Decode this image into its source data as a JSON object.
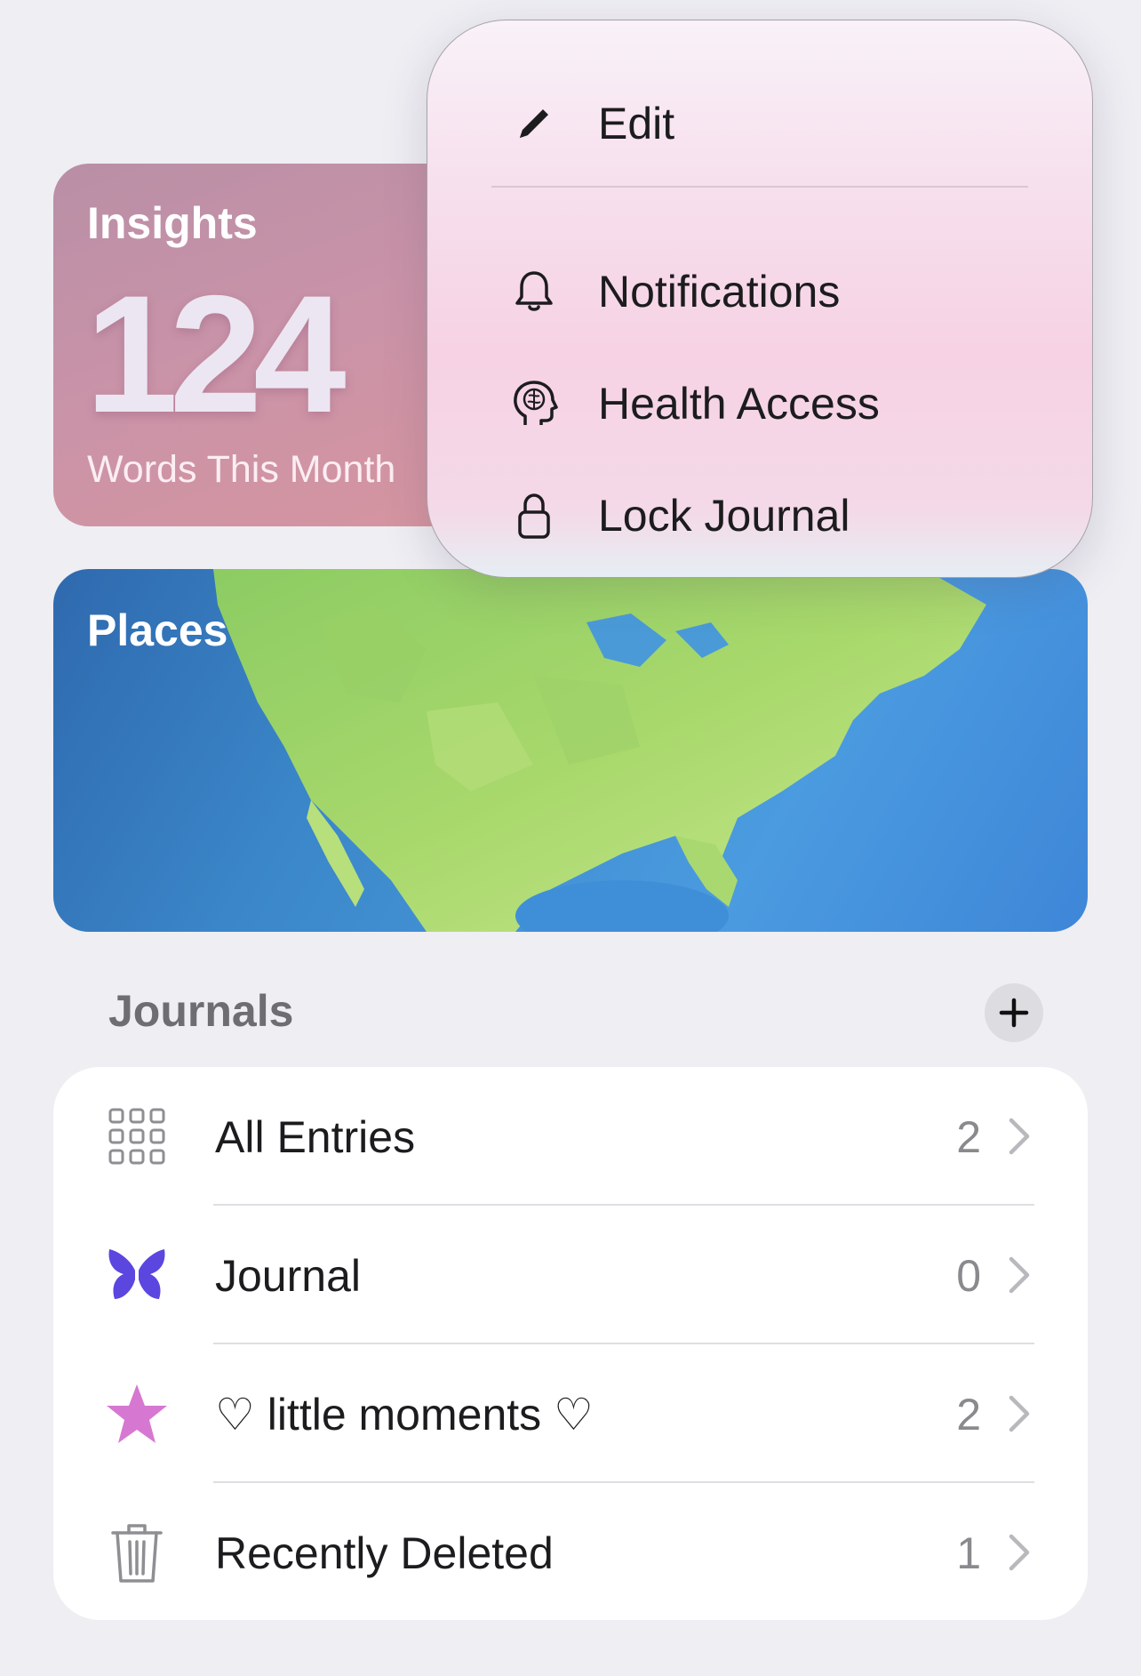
{
  "insights": {
    "title": "Insights",
    "value": "124",
    "caption": "Words This Month"
  },
  "places": {
    "title": "Places"
  },
  "context_menu": {
    "items": [
      {
        "label": "Edit",
        "icon": "pencil-icon"
      },
      {
        "label": "Notifications",
        "icon": "bell-icon"
      },
      {
        "label": "Health Access",
        "icon": "brain-head-icon"
      },
      {
        "label": "Lock Journal",
        "icon": "lock-icon"
      }
    ]
  },
  "journals": {
    "header": "Journals",
    "add_icon": "plus-icon",
    "rows": [
      {
        "label": "All Entries",
        "count": "2",
        "icon": "grid-icon"
      },
      {
        "label": "Journal",
        "count": "0",
        "icon": "butterfly-icon",
        "icon_color": "#5b46e0"
      },
      {
        "label": "♡ little moments ♡",
        "count": "2",
        "icon": "star-icon",
        "icon_color": "#d678d1"
      },
      {
        "label": "Recently Deleted",
        "count": "1",
        "icon": "trash-icon"
      }
    ]
  },
  "colors": {
    "background": "#eeeef3",
    "insights_card": "#c993a8",
    "menu_bg": "#f6d2e4"
  }
}
